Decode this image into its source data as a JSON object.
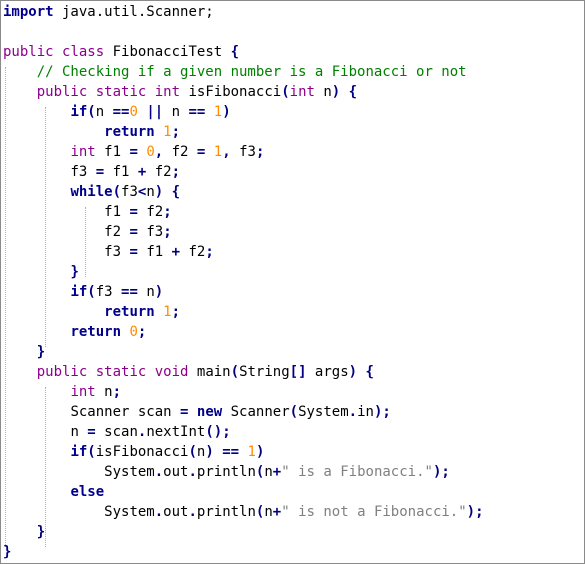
{
  "code": {
    "lines": [
      [
        {
          "t": "import",
          "c": "kw-b"
        },
        {
          "t": " java.util.Scanner;",
          "c": "id"
        }
      ],
      [],
      [
        {
          "t": "public",
          "c": "kw-p"
        },
        {
          "t": " ",
          "c": "id"
        },
        {
          "t": "class",
          "c": "kw-p"
        },
        {
          "t": " FibonacciTest ",
          "c": "id"
        },
        {
          "t": "{",
          "c": "op"
        }
      ],
      [
        {
          "t": "    ",
          "c": "id"
        },
        {
          "t": "// Checking if a given number is a Fibonacci or not",
          "c": "cm"
        }
      ],
      [
        {
          "t": "    ",
          "c": "id"
        },
        {
          "t": "public",
          "c": "kw-p"
        },
        {
          "t": " ",
          "c": "id"
        },
        {
          "t": "static",
          "c": "kw-p"
        },
        {
          "t": " ",
          "c": "id"
        },
        {
          "t": "int",
          "c": "kw-p"
        },
        {
          "t": " isFibonacci",
          "c": "id"
        },
        {
          "t": "(",
          "c": "op"
        },
        {
          "t": "int",
          "c": "kw-p"
        },
        {
          "t": " n",
          "c": "id"
        },
        {
          "t": ")",
          "c": "op"
        },
        {
          "t": " ",
          "c": "id"
        },
        {
          "t": "{",
          "c": "op"
        }
      ],
      [
        {
          "t": "        ",
          "c": "id"
        },
        {
          "t": "if",
          "c": "kw-b"
        },
        {
          "t": "(",
          "c": "op"
        },
        {
          "t": "n ",
          "c": "id"
        },
        {
          "t": "==",
          "c": "op"
        },
        {
          "t": "0",
          "c": "num"
        },
        {
          "t": " ",
          "c": "id"
        },
        {
          "t": "||",
          "c": "op"
        },
        {
          "t": " n ",
          "c": "id"
        },
        {
          "t": "==",
          "c": "op"
        },
        {
          "t": " ",
          "c": "id"
        },
        {
          "t": "1",
          "c": "num"
        },
        {
          "t": ")",
          "c": "op"
        }
      ],
      [
        {
          "t": "            ",
          "c": "id"
        },
        {
          "t": "return",
          "c": "kw-b"
        },
        {
          "t": " ",
          "c": "id"
        },
        {
          "t": "1",
          "c": "num"
        },
        {
          "t": ";",
          "c": "op"
        }
      ],
      [
        {
          "t": "        ",
          "c": "id"
        },
        {
          "t": "int",
          "c": "kw-p"
        },
        {
          "t": " f1 ",
          "c": "id"
        },
        {
          "t": "=",
          "c": "op"
        },
        {
          "t": " ",
          "c": "id"
        },
        {
          "t": "0",
          "c": "num"
        },
        {
          "t": ",",
          "c": "op"
        },
        {
          "t": " f2 ",
          "c": "id"
        },
        {
          "t": "=",
          "c": "op"
        },
        {
          "t": " ",
          "c": "id"
        },
        {
          "t": "1",
          "c": "num"
        },
        {
          "t": ",",
          "c": "op"
        },
        {
          "t": " f3",
          "c": "id"
        },
        {
          "t": ";",
          "c": "op"
        }
      ],
      [
        {
          "t": "        ",
          "c": "id"
        },
        {
          "t": "f3 ",
          "c": "id"
        },
        {
          "t": "=",
          "c": "op"
        },
        {
          "t": " f1 ",
          "c": "id"
        },
        {
          "t": "+",
          "c": "op"
        },
        {
          "t": " f2",
          "c": "id"
        },
        {
          "t": ";",
          "c": "op"
        }
      ],
      [
        {
          "t": "        ",
          "c": "id"
        },
        {
          "t": "while",
          "c": "kw-b"
        },
        {
          "t": "(",
          "c": "op"
        },
        {
          "t": "f3",
          "c": "id"
        },
        {
          "t": "<",
          "c": "op"
        },
        {
          "t": "n",
          "c": "id"
        },
        {
          "t": ")",
          "c": "op"
        },
        {
          "t": " ",
          "c": "id"
        },
        {
          "t": "{",
          "c": "op"
        }
      ],
      [
        {
          "t": "            ",
          "c": "id"
        },
        {
          "t": "f1 ",
          "c": "id"
        },
        {
          "t": "=",
          "c": "op"
        },
        {
          "t": " f2",
          "c": "id"
        },
        {
          "t": ";",
          "c": "op"
        }
      ],
      [
        {
          "t": "            ",
          "c": "id"
        },
        {
          "t": "f2 ",
          "c": "id"
        },
        {
          "t": "=",
          "c": "op"
        },
        {
          "t": " f3",
          "c": "id"
        },
        {
          "t": ";",
          "c": "op"
        }
      ],
      [
        {
          "t": "            ",
          "c": "id"
        },
        {
          "t": "f3 ",
          "c": "id"
        },
        {
          "t": "=",
          "c": "op"
        },
        {
          "t": " f1 ",
          "c": "id"
        },
        {
          "t": "+",
          "c": "op"
        },
        {
          "t": " f2",
          "c": "id"
        },
        {
          "t": ";",
          "c": "op"
        }
      ],
      [
        {
          "t": "        ",
          "c": "id"
        },
        {
          "t": "}",
          "c": "op"
        }
      ],
      [
        {
          "t": "        ",
          "c": "id"
        },
        {
          "t": "if",
          "c": "kw-b"
        },
        {
          "t": "(",
          "c": "op"
        },
        {
          "t": "f3 ",
          "c": "id"
        },
        {
          "t": "==",
          "c": "op"
        },
        {
          "t": " n",
          "c": "id"
        },
        {
          "t": ")",
          "c": "op"
        }
      ],
      [
        {
          "t": "            ",
          "c": "id"
        },
        {
          "t": "return",
          "c": "kw-b"
        },
        {
          "t": " ",
          "c": "id"
        },
        {
          "t": "1",
          "c": "num"
        },
        {
          "t": ";",
          "c": "op"
        }
      ],
      [
        {
          "t": "        ",
          "c": "id"
        },
        {
          "t": "return",
          "c": "kw-b"
        },
        {
          "t": " ",
          "c": "id"
        },
        {
          "t": "0",
          "c": "num"
        },
        {
          "t": ";",
          "c": "op"
        }
      ],
      [
        {
          "t": "    ",
          "c": "id"
        },
        {
          "t": "}",
          "c": "op"
        }
      ],
      [
        {
          "t": "    ",
          "c": "id"
        },
        {
          "t": "public",
          "c": "kw-p"
        },
        {
          "t": " ",
          "c": "id"
        },
        {
          "t": "static",
          "c": "kw-p"
        },
        {
          "t": " ",
          "c": "id"
        },
        {
          "t": "void",
          "c": "kw-p"
        },
        {
          "t": " main",
          "c": "id"
        },
        {
          "t": "(",
          "c": "op"
        },
        {
          "t": "String",
          "c": "id"
        },
        {
          "t": "[]",
          "c": "op"
        },
        {
          "t": " args",
          "c": "id"
        },
        {
          "t": ")",
          "c": "op"
        },
        {
          "t": " ",
          "c": "id"
        },
        {
          "t": "{",
          "c": "op"
        }
      ],
      [
        {
          "t": "        ",
          "c": "id"
        },
        {
          "t": "int",
          "c": "kw-p"
        },
        {
          "t": " n",
          "c": "id"
        },
        {
          "t": ";",
          "c": "op"
        }
      ],
      [
        {
          "t": "        ",
          "c": "id"
        },
        {
          "t": "Scanner scan ",
          "c": "id"
        },
        {
          "t": "=",
          "c": "op"
        },
        {
          "t": " ",
          "c": "id"
        },
        {
          "t": "new",
          "c": "kw-b"
        },
        {
          "t": " Scanner",
          "c": "id"
        },
        {
          "t": "(",
          "c": "op"
        },
        {
          "t": "System",
          "c": "id"
        },
        {
          "t": ".",
          "c": "op"
        },
        {
          "t": "in",
          "c": "id"
        },
        {
          "t": ");",
          "c": "op"
        }
      ],
      [
        {
          "t": "        ",
          "c": "id"
        },
        {
          "t": "n ",
          "c": "id"
        },
        {
          "t": "=",
          "c": "op"
        },
        {
          "t": " scan",
          "c": "id"
        },
        {
          "t": ".",
          "c": "op"
        },
        {
          "t": "nextInt",
          "c": "id"
        },
        {
          "t": "();",
          "c": "op"
        }
      ],
      [
        {
          "t": "        ",
          "c": "id"
        },
        {
          "t": "if",
          "c": "kw-b"
        },
        {
          "t": "(",
          "c": "op"
        },
        {
          "t": "isFibonacci",
          "c": "id"
        },
        {
          "t": "(",
          "c": "op"
        },
        {
          "t": "n",
          "c": "id"
        },
        {
          "t": ")",
          "c": "op"
        },
        {
          "t": " ",
          "c": "id"
        },
        {
          "t": "==",
          "c": "op"
        },
        {
          "t": " ",
          "c": "id"
        },
        {
          "t": "1",
          "c": "num"
        },
        {
          "t": ")",
          "c": "op"
        }
      ],
      [
        {
          "t": "            ",
          "c": "id"
        },
        {
          "t": "System",
          "c": "id"
        },
        {
          "t": ".",
          "c": "op"
        },
        {
          "t": "out",
          "c": "id"
        },
        {
          "t": ".",
          "c": "op"
        },
        {
          "t": "println",
          "c": "id"
        },
        {
          "t": "(",
          "c": "op"
        },
        {
          "t": "n",
          "c": "id"
        },
        {
          "t": "+",
          "c": "op"
        },
        {
          "t": "\" is a Fibonacci.\"",
          "c": "str"
        },
        {
          "t": ");",
          "c": "op"
        }
      ],
      [
        {
          "t": "        ",
          "c": "id"
        },
        {
          "t": "else",
          "c": "kw-b"
        }
      ],
      [
        {
          "t": "            ",
          "c": "id"
        },
        {
          "t": "System",
          "c": "id"
        },
        {
          "t": ".",
          "c": "op"
        },
        {
          "t": "out",
          "c": "id"
        },
        {
          "t": ".",
          "c": "op"
        },
        {
          "t": "println",
          "c": "id"
        },
        {
          "t": "(",
          "c": "op"
        },
        {
          "t": "n",
          "c": "id"
        },
        {
          "t": "+",
          "c": "op"
        },
        {
          "t": "\" is not a Fibonacci.\"",
          "c": "str"
        },
        {
          "t": ");",
          "c": "op"
        }
      ],
      [
        {
          "t": "    ",
          "c": "id"
        },
        {
          "t": "}",
          "c": "op"
        }
      ],
      [
        {
          "t": "}",
          "c": "op"
        }
      ]
    ]
  },
  "colors": {
    "keyword_bold": "#00008b",
    "keyword_type": "#8b008b",
    "comment": "#008000",
    "number": "#ff8c00",
    "string": "#808080",
    "operator": "#000080"
  }
}
